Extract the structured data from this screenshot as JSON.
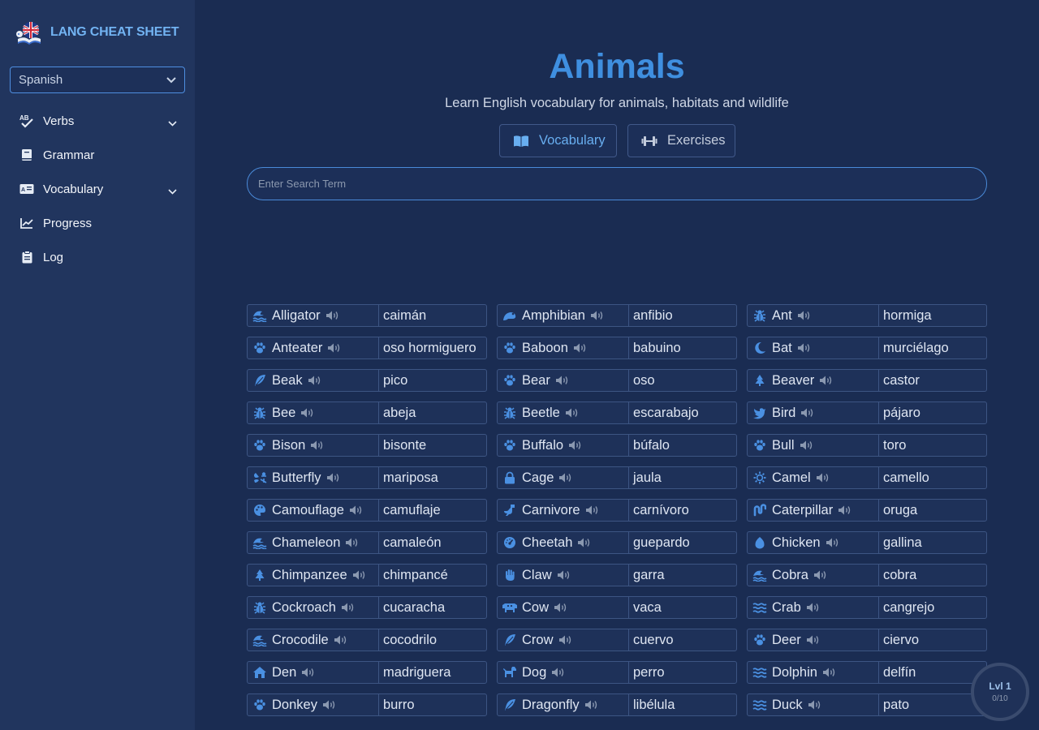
{
  "brand": {
    "title": "LANG CHEAT SHEET"
  },
  "language_select": {
    "value": "Spanish"
  },
  "nav": [
    {
      "label": "Verbs",
      "icon": "spellcheck-icon",
      "has_submenu": true
    },
    {
      "label": "Grammar",
      "icon": "book-icon",
      "has_submenu": false
    },
    {
      "label": "Vocabulary",
      "icon": "id-card-icon",
      "has_submenu": true
    },
    {
      "label": "Progress",
      "icon": "chart-line-icon",
      "has_submenu": false
    },
    {
      "label": "Log",
      "icon": "clipboard-icon",
      "has_submenu": false
    }
  ],
  "page": {
    "title": "Animals",
    "subtitle": "Learn English vocabulary for animals, habitats and wildlife"
  },
  "tabs": [
    {
      "label": "Vocabulary",
      "icon": "book-open-icon",
      "active": true
    },
    {
      "label": "Exercises",
      "icon": "dumbbell-icon",
      "active": false
    }
  ],
  "search": {
    "placeholder": "Enter Search Term",
    "value": ""
  },
  "vocab": [
    {
      "en": "Alligator",
      "es": "caimán",
      "icon": "water-icon"
    },
    {
      "en": "Amphibian",
      "es": "anfibio",
      "icon": "frog-icon"
    },
    {
      "en": "Ant",
      "es": "hormiga",
      "icon": "bug-icon"
    },
    {
      "en": "Anteater",
      "es": "oso hormiguero",
      "icon": "paw-icon"
    },
    {
      "en": "Baboon",
      "es": "babuino",
      "icon": "paw-icon"
    },
    {
      "en": "Bat",
      "es": "murciélago",
      "icon": "moon-icon"
    },
    {
      "en": "Beak",
      "es": "pico",
      "icon": "feather-icon"
    },
    {
      "en": "Bear",
      "es": "oso",
      "icon": "paw-icon"
    },
    {
      "en": "Beaver",
      "es": "castor",
      "icon": "tree-icon"
    },
    {
      "en": "Bee",
      "es": "abeja",
      "icon": "bug-icon"
    },
    {
      "en": "Beetle",
      "es": "escarabajo",
      "icon": "bug-icon"
    },
    {
      "en": "Bird",
      "es": "pájaro",
      "icon": "bird-icon"
    },
    {
      "en": "Bison",
      "es": "bisonte",
      "icon": "paw-icon"
    },
    {
      "en": "Buffalo",
      "es": "búfalo",
      "icon": "paw-icon"
    },
    {
      "en": "Bull",
      "es": "toro",
      "icon": "paw-icon"
    },
    {
      "en": "Butterfly",
      "es": "mariposa",
      "icon": "butterfly-icon"
    },
    {
      "en": "Cage",
      "es": "jaula",
      "icon": "lock-icon"
    },
    {
      "en": "Camel",
      "es": "camello",
      "icon": "sun-icon"
    },
    {
      "en": "Camouflage",
      "es": "camuflaje",
      "icon": "palette-icon"
    },
    {
      "en": "Carnivore",
      "es": "carnívoro",
      "icon": "dinosaur-icon"
    },
    {
      "en": "Caterpillar",
      "es": "oruga",
      "icon": "worm-icon"
    },
    {
      "en": "Chameleon",
      "es": "camaleón",
      "icon": "water-icon"
    },
    {
      "en": "Cheetah",
      "es": "guepardo",
      "icon": "speedometer-icon"
    },
    {
      "en": "Chicken",
      "es": "gallina",
      "icon": "egg-icon"
    },
    {
      "en": "Chimpanzee",
      "es": "chimpancé",
      "icon": "tree-icon"
    },
    {
      "en": "Claw",
      "es": "garra",
      "icon": "hand-icon"
    },
    {
      "en": "Cobra",
      "es": "cobra",
      "icon": "water-icon"
    },
    {
      "en": "Cockroach",
      "es": "cucaracha",
      "icon": "bug-icon"
    },
    {
      "en": "Cow",
      "es": "vaca",
      "icon": "cow-icon"
    },
    {
      "en": "Crab",
      "es": "cangrejo",
      "icon": "waves-icon"
    },
    {
      "en": "Crocodile",
      "es": "cocodrilo",
      "icon": "water-icon"
    },
    {
      "en": "Crow",
      "es": "cuervo",
      "icon": "feather-icon"
    },
    {
      "en": "Deer",
      "es": "ciervo",
      "icon": "paw-icon"
    },
    {
      "en": "Den",
      "es": "madriguera",
      "icon": "house-icon"
    },
    {
      "en": "Dog",
      "es": "perro",
      "icon": "dog-icon"
    },
    {
      "en": "Dolphin",
      "es": "delfín",
      "icon": "waves-icon"
    },
    {
      "en": "Donkey",
      "es": "burro",
      "icon": "paw-icon"
    },
    {
      "en": "Dragonfly",
      "es": "libélula",
      "icon": "feather-icon"
    },
    {
      "en": "Duck",
      "es": "pato",
      "icon": "waves-icon"
    }
  ],
  "level": {
    "label": "Lvl 1",
    "progress": "0/10"
  },
  "colors": {
    "accent": "#3f8fe0",
    "background": "#1a2c52",
    "sidebar": "#21355e"
  }
}
